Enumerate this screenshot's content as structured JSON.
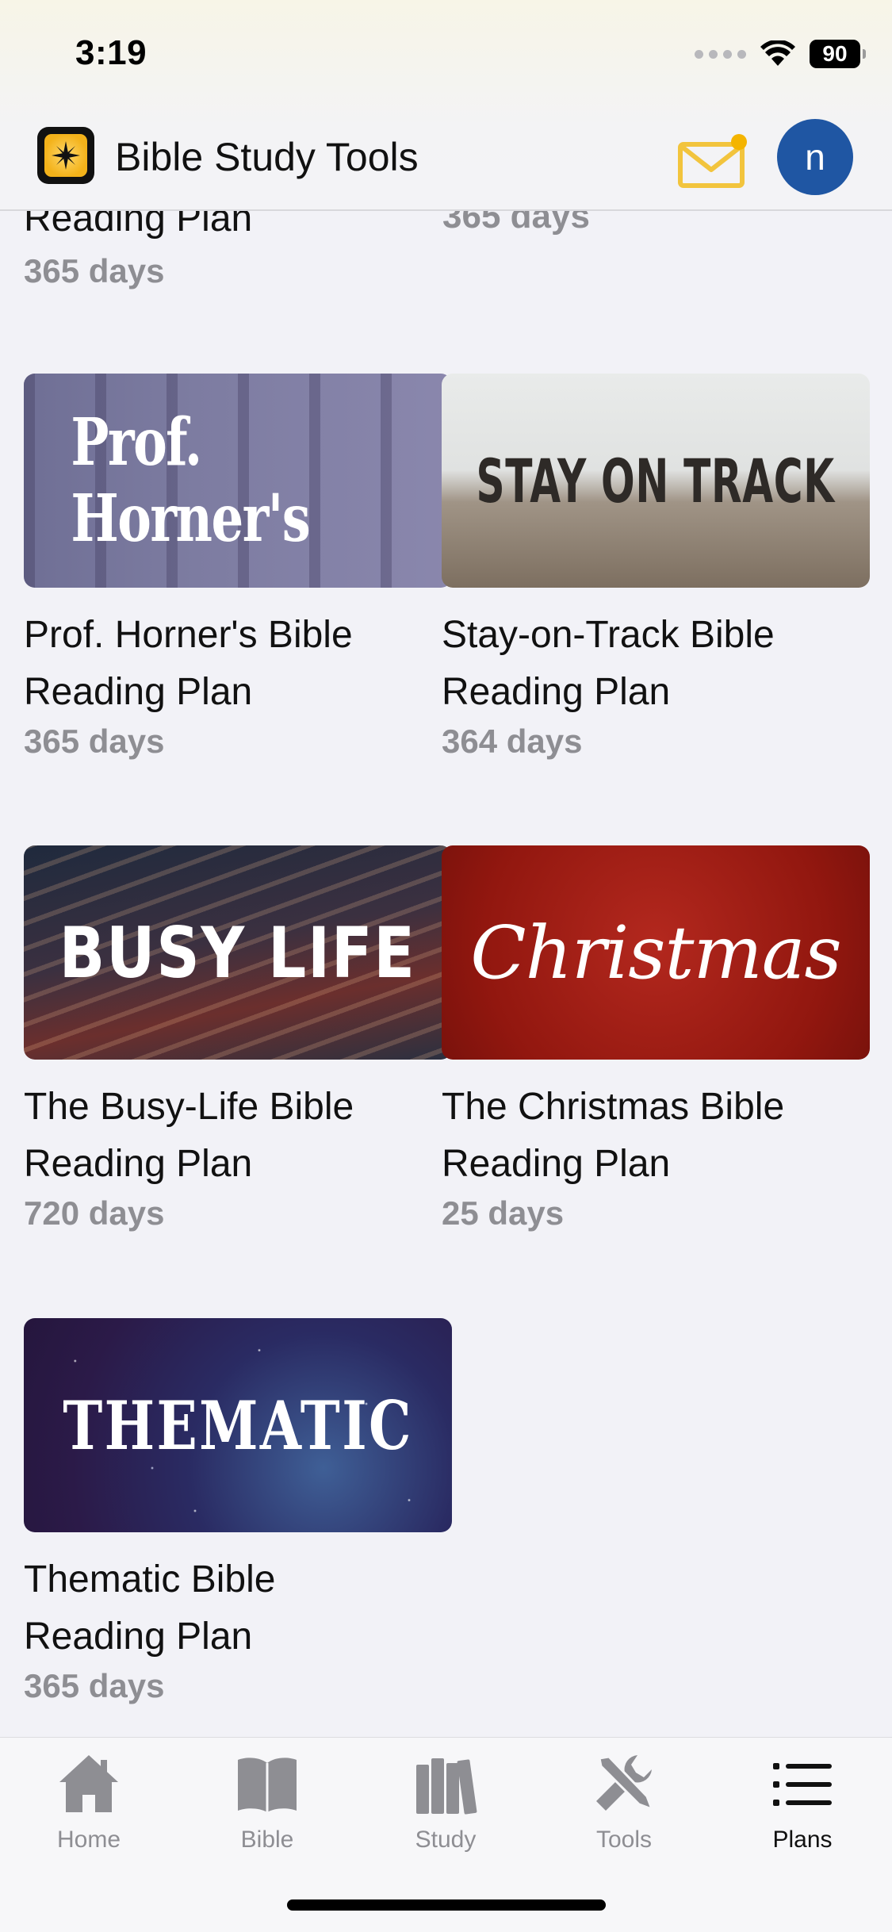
{
  "status": {
    "time": "3:19",
    "battery": "90"
  },
  "header": {
    "app_title": "Bible Study Tools",
    "avatar_initial": "n"
  },
  "partial_row": {
    "left_title": "Reading Plan",
    "left_days": "365 days",
    "right_days": "365 days"
  },
  "plans": [
    {
      "image_text": "Prof. Horner's",
      "title": "Prof. Horner's Bible Reading Plan",
      "days": "365 days"
    },
    {
      "image_text": "STAY ON TRACK",
      "title": "Stay-on-Track Bible Reading Plan",
      "days": "364 days"
    },
    {
      "image_text": "BUSY LIFE",
      "title": "The Busy-Life Bible Reading Plan",
      "days": "720 days"
    },
    {
      "image_text": "Christmas",
      "title": "The Christmas Bible Reading Plan",
      "days": "25 days"
    },
    {
      "image_text": "THEMATIC",
      "title": "Thematic Bible Reading Plan",
      "days": "365 days"
    }
  ],
  "tabs": [
    {
      "label": "Home",
      "icon": "home-icon",
      "active": false
    },
    {
      "label": "Bible",
      "icon": "book-icon",
      "active": false
    },
    {
      "label": "Study",
      "icon": "books-icon",
      "active": false
    },
    {
      "label": "Tools",
      "icon": "tools-icon",
      "active": false
    },
    {
      "label": "Plans",
      "icon": "list-icon",
      "active": true
    }
  ],
  "colors": {
    "avatar": "#1f56a3",
    "mail_icon": "#f2c43d",
    "notification_dot": "#f4b400",
    "tab_inactive": "#8e8e93",
    "tab_active": "#111111"
  }
}
